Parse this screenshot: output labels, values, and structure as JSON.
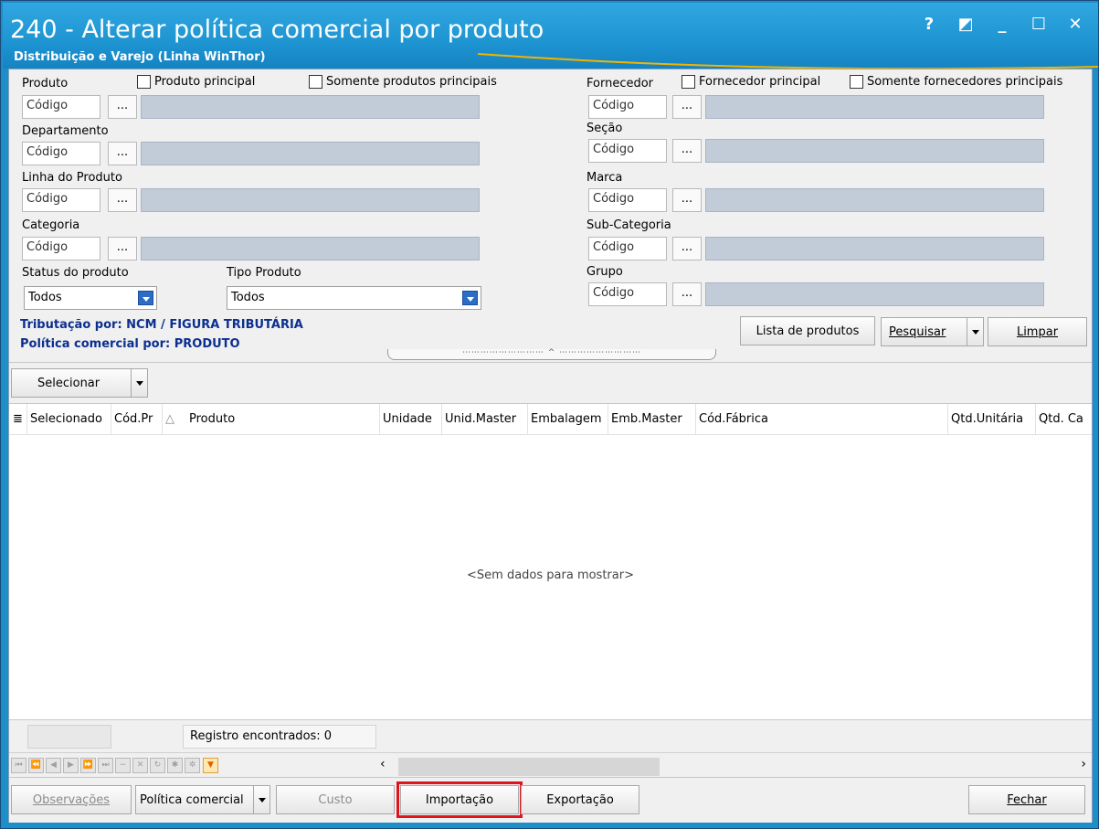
{
  "window": {
    "title": "240 - Alterar política comercial por produto",
    "subtitle": "Distribuição e Varejo (Linha WinThor)",
    "help_label": "?",
    "restore_label": "◩",
    "minimize_label": "_",
    "maximize_label": "☐",
    "close_label": "✕"
  },
  "filters": {
    "code_placeholder": "Código",
    "lookup_label": "...",
    "produto": {
      "label": "Produto",
      "chk1": "Produto principal",
      "chk2": "Somente produtos principais"
    },
    "departamento": {
      "label": "Departamento"
    },
    "linha": {
      "label": "Linha do Produto"
    },
    "categoria": {
      "label": "Categoria"
    },
    "status": {
      "label": "Status do produto",
      "value": "Todos"
    },
    "tipo": {
      "label": "Tipo Produto",
      "value": "Todos"
    },
    "fornecedor": {
      "label": "Fornecedor",
      "chk1": "Fornecedor principal",
      "chk2": "Somente fornecedores principais"
    },
    "secao": {
      "label": "Seção"
    },
    "marca": {
      "label": "Marca"
    },
    "subcategoria": {
      "label": "Sub-Categoria"
    },
    "grupo": {
      "label": "Grupo"
    }
  },
  "info": {
    "tributacao": "Tributação por: NCM / FIGURA TRIBUTÁRIA",
    "politica": "Política comercial por: PRODUTO"
  },
  "actions": {
    "lista_produtos": "Lista de produtos",
    "pesquisar": "Pesquisar",
    "limpar": "Limpar"
  },
  "toolbar": {
    "selecionar": "Selecionar"
  },
  "grid": {
    "columns": [
      "Selecionado",
      "Cód.Pr",
      "Produto",
      "Unidade",
      "Unid.Master",
      "Embalagem",
      "Emb.Master",
      "Cód.Fábrica",
      "Qtd.Unitária",
      "Qtd. Ca"
    ],
    "sort_indicator": "△",
    "empty_message": "<Sem dados para mostrar>"
  },
  "footer": {
    "registros": "Registro encontrados: 0"
  },
  "bottom_buttons": {
    "observacoes": "Observações",
    "politica_comercial": "Política comercial",
    "custo": "Custo",
    "importacao": "Importação",
    "exportacao": "Exportação",
    "fechar": "Fechar"
  },
  "colors": {
    "title_bar": "#1e95d2",
    "info_text": "#0c2f8f",
    "highlight": "#e0141c",
    "combo_arrow": "#2b6cc4"
  }
}
